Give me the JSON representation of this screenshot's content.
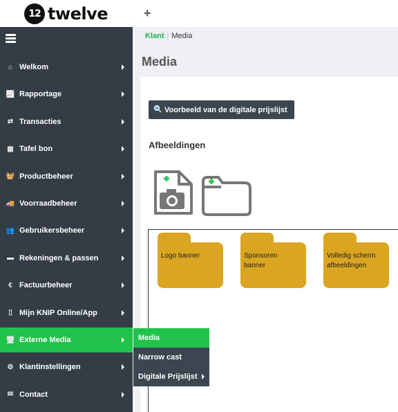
{
  "brand": {
    "mark": "12",
    "name": "twelve"
  },
  "tabs": {
    "add_tab_icon": "plus-icon"
  },
  "sidebar": {
    "menu_icon": "hamburger-icon",
    "items": [
      {
        "label": "Welkom",
        "icon": "home-icon",
        "glyph": "⌂"
      },
      {
        "label": "Rapportage",
        "icon": "line-chart-icon",
        "glyph": "📈"
      },
      {
        "label": "Transacties",
        "icon": "exchange-icon",
        "glyph": "⇄"
      },
      {
        "label": "Tafel bon",
        "icon": "grid-icon",
        "glyph": "▦"
      },
      {
        "label": "Productbeheer",
        "icon": "basket-icon",
        "glyph": "🧺"
      },
      {
        "label": "Voorraadbeheer",
        "icon": "truck-icon",
        "glyph": "🚚"
      },
      {
        "label": "Gebruikersbeheer",
        "icon": "users-icon",
        "glyph": "👥"
      },
      {
        "label": "Rekeningen & passen",
        "icon": "credit-card-icon",
        "glyph": "▬"
      },
      {
        "label": "Factuurbeheer",
        "icon": "euro-icon",
        "glyph": "€"
      },
      {
        "label": "Mijn KNIP Online/App",
        "icon": "mobile-icon",
        "glyph": "▯"
      },
      {
        "label": "Externe Media",
        "icon": "monitor-icon",
        "glyph": "🖥"
      },
      {
        "label": "Klantinstellingen",
        "icon": "cogs-icon",
        "glyph": "⚙"
      },
      {
        "label": "Contact",
        "icon": "envelope-icon",
        "glyph": "✉"
      }
    ],
    "active_index": 10
  },
  "submenu": {
    "items": [
      {
        "label": "Media"
      },
      {
        "label": "Narrow cast"
      },
      {
        "label": "Digitale Prijslijst"
      }
    ]
  },
  "breadcrumb": {
    "parent": "Klant",
    "separator": "|",
    "current": "Media"
  },
  "page": {
    "title": "Media",
    "preview_button": "Voorbeeld van de digitale prijslijst",
    "preview_icon": "search-icon",
    "section_title": "Afbeeldingen",
    "add_image_icon": "add-image-icon",
    "add_folder_icon": "add-folder-icon"
  },
  "folders": [
    {
      "label": "Logo banner"
    },
    {
      "label": "Sponsoren banner"
    },
    {
      "label": "Volledig scherm afbeeldingen"
    }
  ],
  "colors": {
    "accent": "#22c34a",
    "sidebar_bg": "#343d46",
    "folder": "#daa520",
    "button_bg": "#3c4650"
  }
}
